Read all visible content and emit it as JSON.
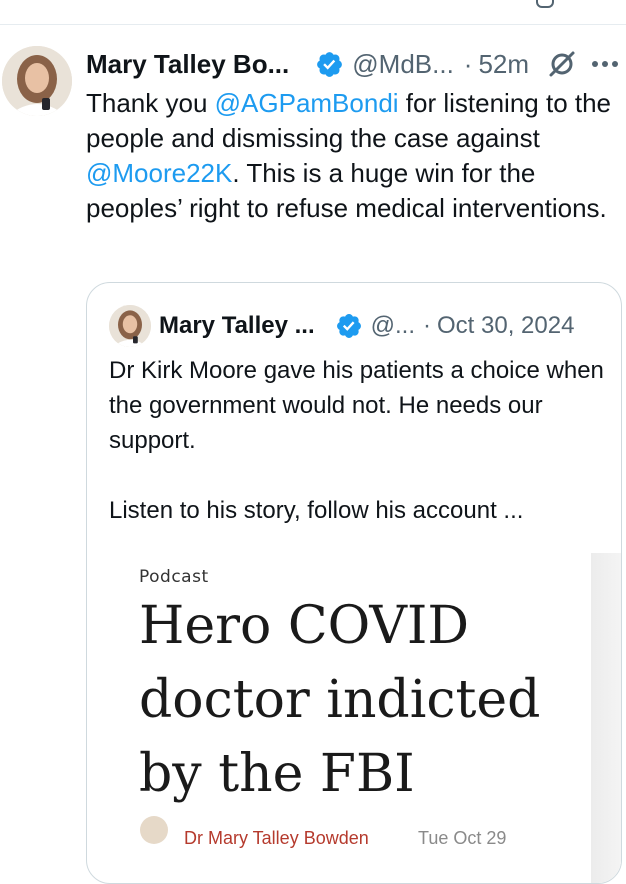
{
  "tweet": {
    "author_name": "Mary Talley Bo...",
    "author_handle": "@MdB...",
    "separator": "·",
    "time": "52m",
    "text_segments": [
      {
        "text": "Thank you ",
        "type": "text"
      },
      {
        "text": "@AGPamBondi",
        "type": "mention"
      },
      {
        "text": " for listening to the people and dismissing the case against ",
        "type": "text"
      },
      {
        "text": "@Moore22K",
        "type": "mention"
      },
      {
        "text": ". This is a huge win for the peoples’ right to refuse medical interventions.",
        "type": "text"
      }
    ]
  },
  "quote": {
    "author_name": "Mary Talley ...",
    "author_handle": "@...",
    "separator": "·",
    "date": "Oct 30, 2024",
    "paragraph1": "Dr Kirk Moore gave his patients a choice when the government would not.  He needs our support.",
    "paragraph2": "Listen to his story, follow his account ...",
    "media": {
      "label": "Podcast",
      "headline": "Hero COVID doctor indicted by the FBI",
      "byline_author": "Dr Mary Talley Bowden",
      "byline_date": "Tue Oct 29"
    }
  },
  "icons": {
    "verified": "verified-badge-icon",
    "grok": "grok-icon",
    "more": "more-options-icon"
  },
  "colors": {
    "mention": "#1d9bf0",
    "verified": "#1d9bf0",
    "secondary_text": "#536471",
    "byline_author": "#b53a2d"
  }
}
